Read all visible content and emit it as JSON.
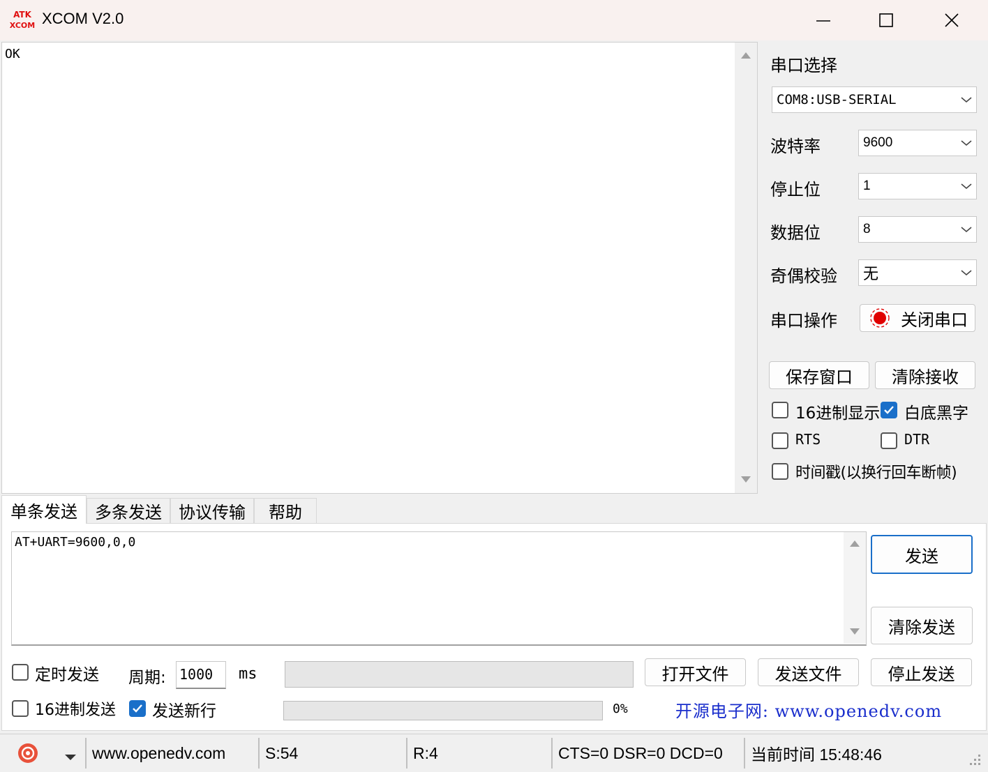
{
  "window": {
    "title": "XCOM V2.0",
    "logo_top": "ATK",
    "logo_bottom": "XCOM"
  },
  "receive": {
    "text": "OK"
  },
  "serial": {
    "port_label": "串口选择",
    "port_value": "COM8:USB-SERIAL",
    "baud_label": "波特率",
    "baud_value": "9600",
    "stopbits_label": "停止位",
    "stopbits_value": "1",
    "databits_label": "数据位",
    "databits_value": "8",
    "parity_label": "奇偶校验",
    "parity_value": "无",
    "operation_label": "串口操作",
    "operation_button": "关闭串口"
  },
  "actions": {
    "save_window": "保存窗口",
    "clear_receive": "清除接收"
  },
  "options": {
    "hex_display": {
      "label": "16进制显示",
      "checked": false
    },
    "white_bg": {
      "label": "白底黑字",
      "checked": true
    },
    "rts": {
      "label": "RTS",
      "checked": false
    },
    "dtr": {
      "label": "DTR",
      "checked": false
    },
    "timestamp": {
      "label": "时间戳(以换行回车断帧)",
      "checked": false
    }
  },
  "tabs": [
    "单条发送",
    "多条发送",
    "协议传输",
    "帮助"
  ],
  "send": {
    "text": "AT+UART=9600,0,0",
    "send_button": "发送",
    "clear_send_button": "清除发送",
    "timed_send": {
      "label": "定时发送",
      "checked": false
    },
    "period_label": "周期:",
    "period_value": "1000",
    "period_unit": "ms",
    "open_file": "打开文件",
    "send_file": "发送文件",
    "stop_send": "停止发送",
    "hex_send": {
      "label": "16进制发送",
      "checked": false
    },
    "send_newline": {
      "label": "发送新行",
      "checked": true
    },
    "progress_percent": "0%",
    "progress_value": 0,
    "banner": "开源电子网: www.openedv.com"
  },
  "status": {
    "website": "www.openedv.com",
    "sent": "S:54",
    "received": "R:4",
    "lines": "CTS=0 DSR=0 DCD=0",
    "time_label": "当前时间 15:48:46"
  },
  "colors": {
    "accent": "#1a6fc9",
    "logo_red": "#e01010",
    "banner_blue": "#1a2ecc"
  }
}
